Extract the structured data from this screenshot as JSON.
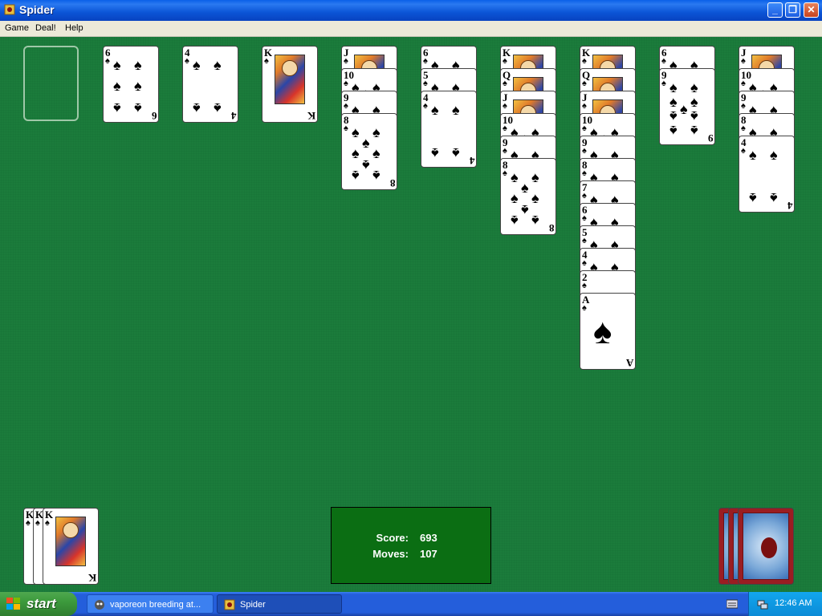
{
  "window": {
    "title": "Spider",
    "icon": "spider-app-icon"
  },
  "menu": {
    "items": [
      "Game",
      "Deal!",
      "Help"
    ]
  },
  "foundation": {
    "completed_suits": 0
  },
  "tableau": [
    {
      "column": 1,
      "cards": []
    },
    {
      "column": 2,
      "cards": [
        {
          "rank": "6",
          "suit": "♠"
        }
      ]
    },
    {
      "column": 3,
      "cards": [
        {
          "rank": "4",
          "suit": "♠"
        }
      ]
    },
    {
      "column": 4,
      "cards": [
        {
          "rank": "K",
          "suit": "♠"
        }
      ]
    },
    {
      "column": 5,
      "cards": [
        {
          "rank": "J",
          "suit": "♠"
        },
        {
          "rank": "10",
          "suit": "♠"
        },
        {
          "rank": "9",
          "suit": "♠"
        },
        {
          "rank": "8",
          "suit": "♠"
        }
      ]
    },
    {
      "column": 6,
      "cards": [
        {
          "rank": "6",
          "suit": "♠"
        },
        {
          "rank": "5",
          "suit": "♠"
        },
        {
          "rank": "4",
          "suit": "♠"
        }
      ]
    },
    {
      "column": 7,
      "cards": [
        {
          "rank": "K",
          "suit": "♠"
        },
        {
          "rank": "Q",
          "suit": "♠"
        },
        {
          "rank": "J",
          "suit": "♠"
        },
        {
          "rank": "10",
          "suit": "♠"
        },
        {
          "rank": "9",
          "suit": "♠"
        },
        {
          "rank": "8",
          "suit": "♠"
        }
      ]
    },
    {
      "column": 8,
      "cards": [
        {
          "rank": "K",
          "suit": "♠"
        },
        {
          "rank": "Q",
          "suit": "♠"
        },
        {
          "rank": "J",
          "suit": "♠"
        },
        {
          "rank": "10",
          "suit": "♠"
        },
        {
          "rank": "9",
          "suit": "♠"
        },
        {
          "rank": "8",
          "suit": "♠"
        },
        {
          "rank": "7",
          "suit": "♠"
        },
        {
          "rank": "6",
          "suit": "♠"
        },
        {
          "rank": "5",
          "suit": "♠"
        },
        {
          "rank": "4",
          "suit": "♠"
        },
        {
          "rank": "2",
          "suit": "♠"
        },
        {
          "rank": "A",
          "suit": "♠"
        }
      ]
    },
    {
      "column": 9,
      "cards": [
        {
          "rank": "6",
          "suit": "♠"
        },
        {
          "rank": "9",
          "suit": "♠"
        }
      ]
    },
    {
      "column": 10,
      "cards": [
        {
          "rank": "J",
          "suit": "♠"
        },
        {
          "rank": "10",
          "suit": "♠"
        },
        {
          "rank": "9",
          "suit": "♠"
        },
        {
          "rank": "8",
          "suit": "♠"
        },
        {
          "rank": "4",
          "suit": "♠"
        }
      ]
    }
  ],
  "completed_stack": {
    "cards": [
      {
        "rank": "K",
        "suit": "♠"
      },
      {
        "rank": "K",
        "suit": "♠"
      },
      {
        "rank": "K",
        "suit": "♠"
      }
    ]
  },
  "stock": {
    "remaining_deals": 3
  },
  "score": {
    "score_label": "Score:",
    "score_value": "693",
    "moves_label": "Moves:",
    "moves_value": "107"
  },
  "taskbar": {
    "start_label": "start",
    "tasks": [
      {
        "label": "vaporeon breeding at...",
        "icon": "browser-icon",
        "active": false
      },
      {
        "label": "Spider",
        "icon": "spider-app-icon",
        "active": true
      }
    ],
    "clock": "12:46 AM"
  },
  "colors": {
    "felt": "#1b7c3b",
    "score_bg": "#0b6e13",
    "card_back": "#9a1d22"
  }
}
